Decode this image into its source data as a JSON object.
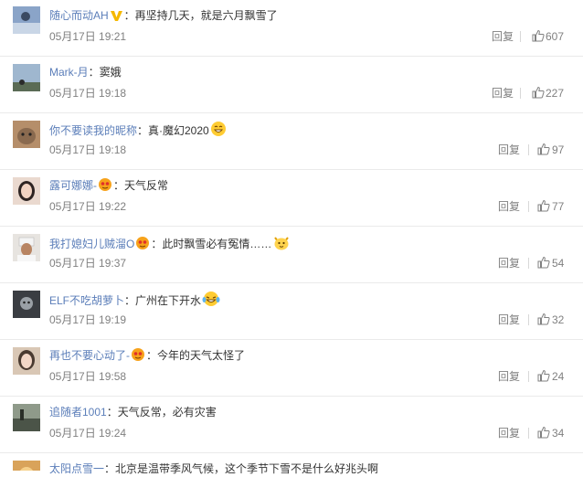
{
  "comments": [
    {
      "user": "随心而动AH",
      "badge": "vip-v",
      "text": "：再坚持几天，就是六月飘雪了",
      "emoji": "",
      "time": "05月17日 19:21",
      "reply": "回复",
      "likes": "607"
    },
    {
      "user": "Mark-月",
      "badge": "",
      "text": "：窦娥",
      "emoji": "",
      "time": "05月17日 19:18",
      "reply": "回复",
      "likes": "227"
    },
    {
      "user": "你不要读我的昵称",
      "badge": "",
      "text": "：真·魔幻2020",
      "emoji": "laugh-emoji",
      "time": "05月17日 19:18",
      "reply": "回复",
      "likes": "97"
    },
    {
      "user": "露可娜娜-",
      "badge": "member-face",
      "text": "：天气反常",
      "emoji": "",
      "time": "05月17日 19:22",
      "reply": "回复",
      "likes": "77"
    },
    {
      "user": "我打媳妇儿贼溜O",
      "badge": "member-face",
      "text": "：此时飘雪必有冤情……",
      "emoji": "cat-emoji",
      "time": "05月17日 19:37",
      "reply": "回复",
      "likes": "54"
    },
    {
      "user": "ELF不吃胡萝卜",
      "badge": "",
      "text": "：广州在下开水",
      "emoji": "tears-laugh-emoji",
      "time": "05月17日 19:19",
      "reply": "回复",
      "likes": "32"
    },
    {
      "user": "再也不要心动了-",
      "badge": "member-face",
      "text": "：今年的天气太怪了",
      "emoji": "",
      "time": "05月17日 19:58",
      "reply": "回复",
      "likes": "24"
    },
    {
      "user": "追随者1001",
      "badge": "",
      "text": "：天气反常，必有灾害",
      "emoji": "",
      "time": "05月17日 19:24",
      "reply": "回复",
      "likes": "34"
    },
    {
      "user": "太阳点雪一",
      "badge": "",
      "text": "：北京是温带季风气候，这个季节下雪不是什么好兆头啊",
      "emoji": "",
      "time": "",
      "reply": "",
      "likes": ""
    }
  ],
  "colors": {
    "username": "#5b7eb9",
    "meta": "#808080",
    "text": "#333333",
    "divider": "#eaeaea"
  }
}
